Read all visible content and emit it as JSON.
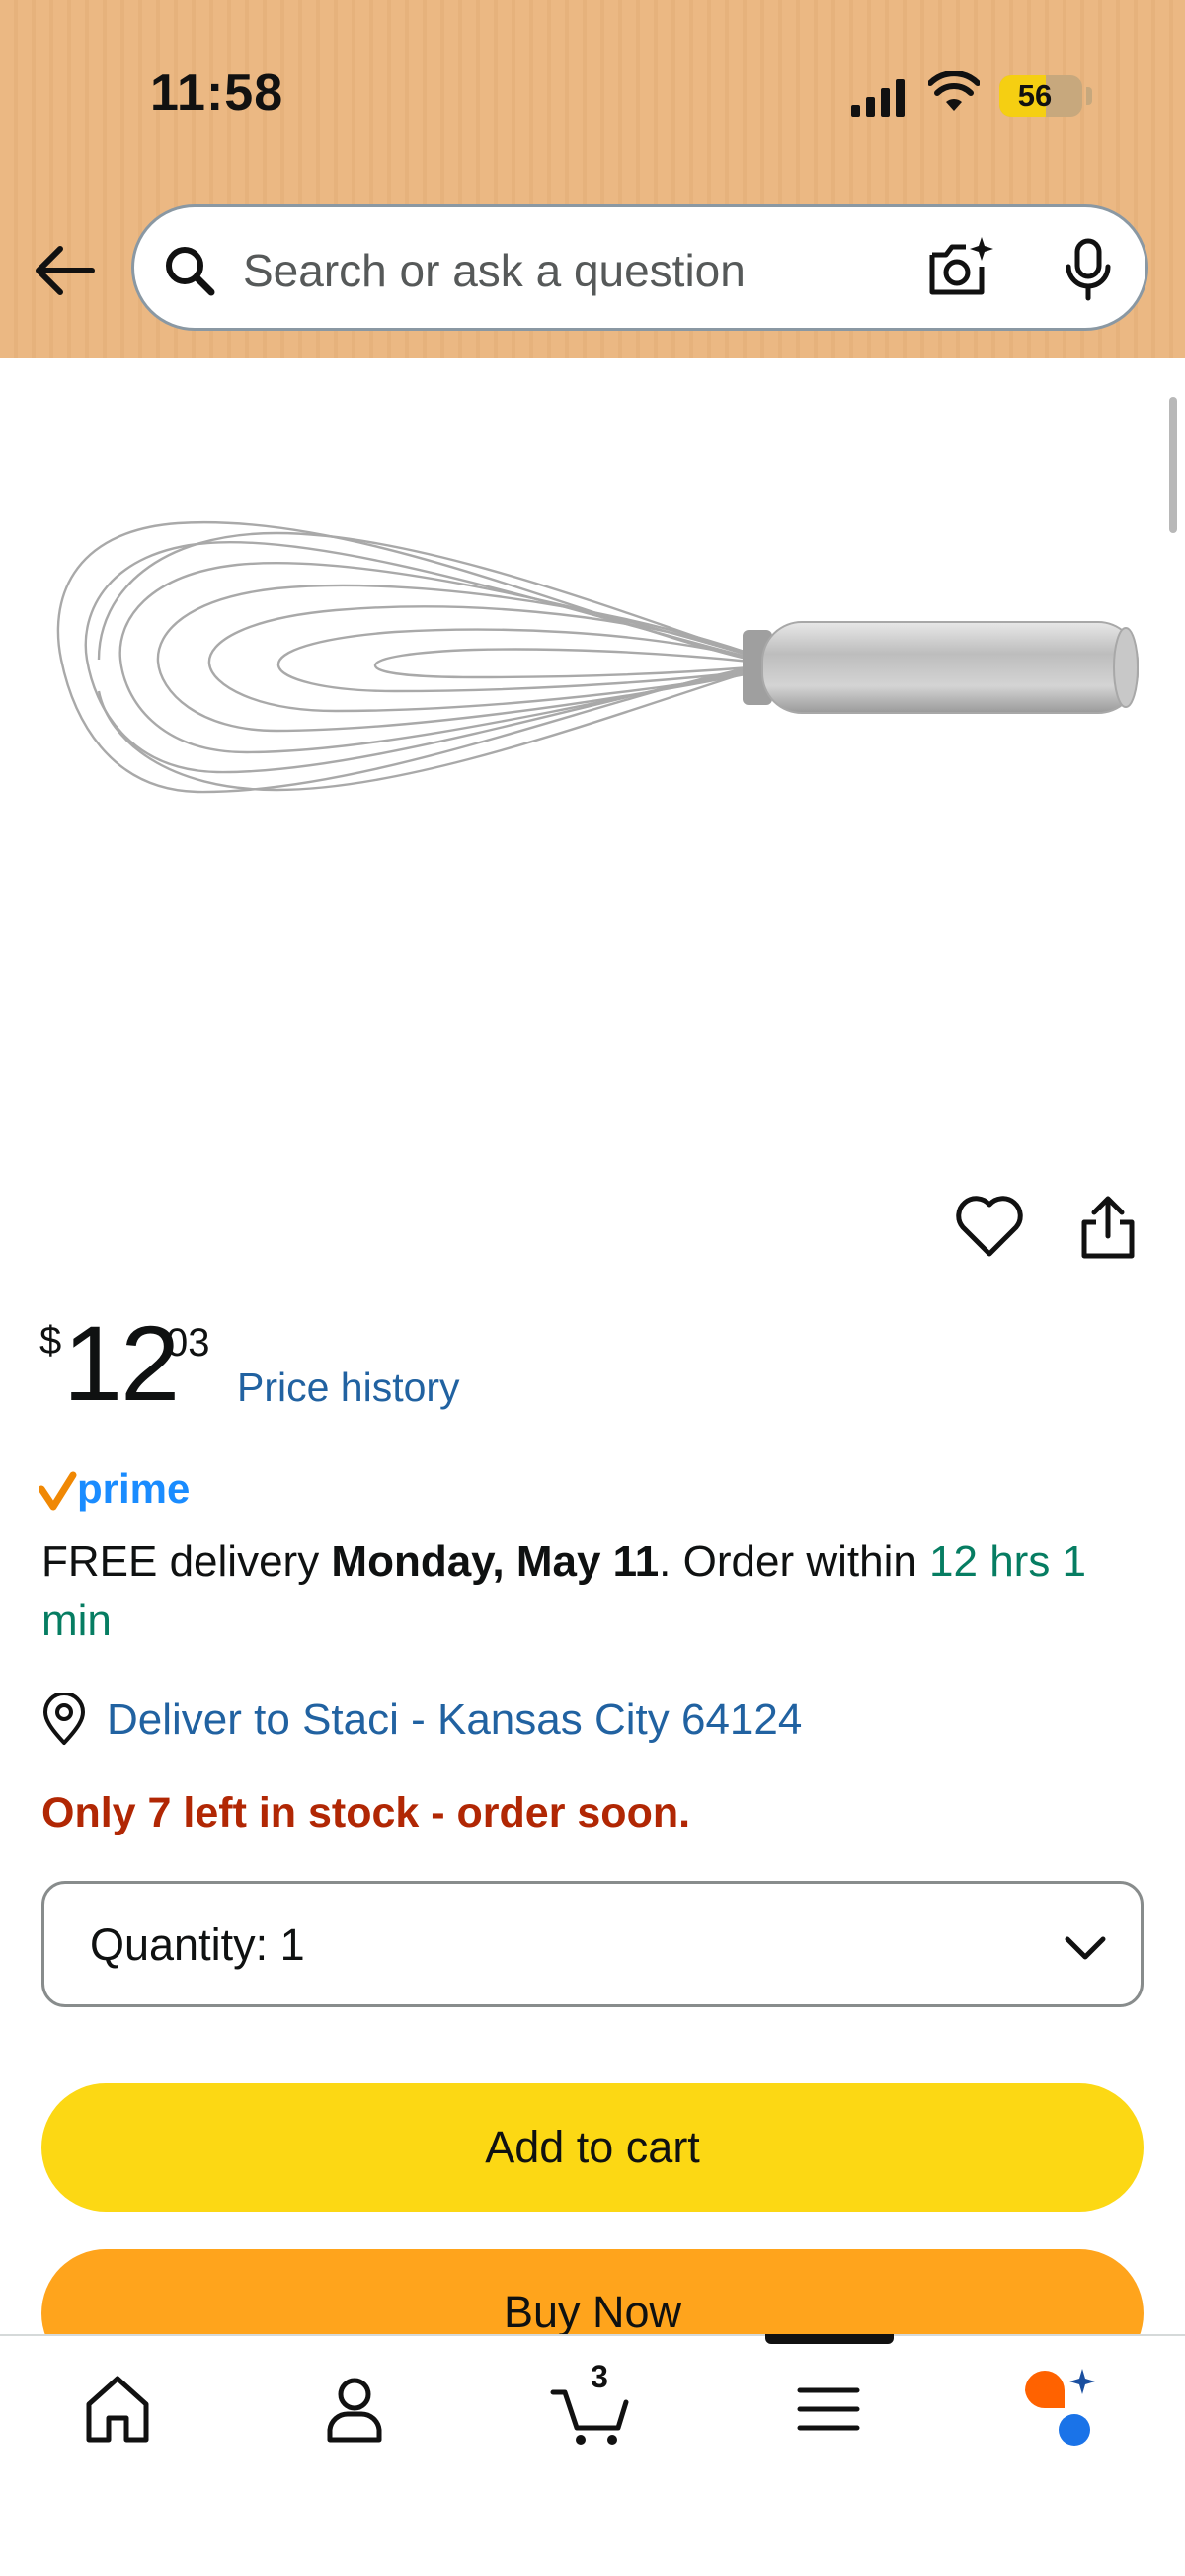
{
  "status_bar": {
    "time": "11:58",
    "battery": "56",
    "battery_level": 0.56
  },
  "header": {
    "search_placeholder": "Search or ask a question"
  },
  "product": {
    "price_symbol": "$",
    "price_whole": "12",
    "price_fraction": "03",
    "price_history_label": "Price history",
    "prime_label": "prime",
    "delivery_prefix": "FREE delivery ",
    "delivery_date": "Monday, May 11",
    "delivery_middle": ". Order within ",
    "delivery_countdown": "12 hrs 1 min",
    "deliver_to": "Deliver to Staci - Kansas City 64124",
    "stock_message": "Only 7 left in stock - order soon.",
    "quantity_label": "Quantity: 1",
    "add_to_cart_label": "Add to cart",
    "buy_now_label": "Buy Now"
  },
  "bottom_nav": {
    "cart_count": "3"
  },
  "colors": {
    "header_bg": "#ebb883",
    "link": "#2162a1",
    "green": "#067d62",
    "stock_red": "#b12704",
    "add_to_cart": "#fcd814",
    "buy_now": "#ffa41c"
  }
}
